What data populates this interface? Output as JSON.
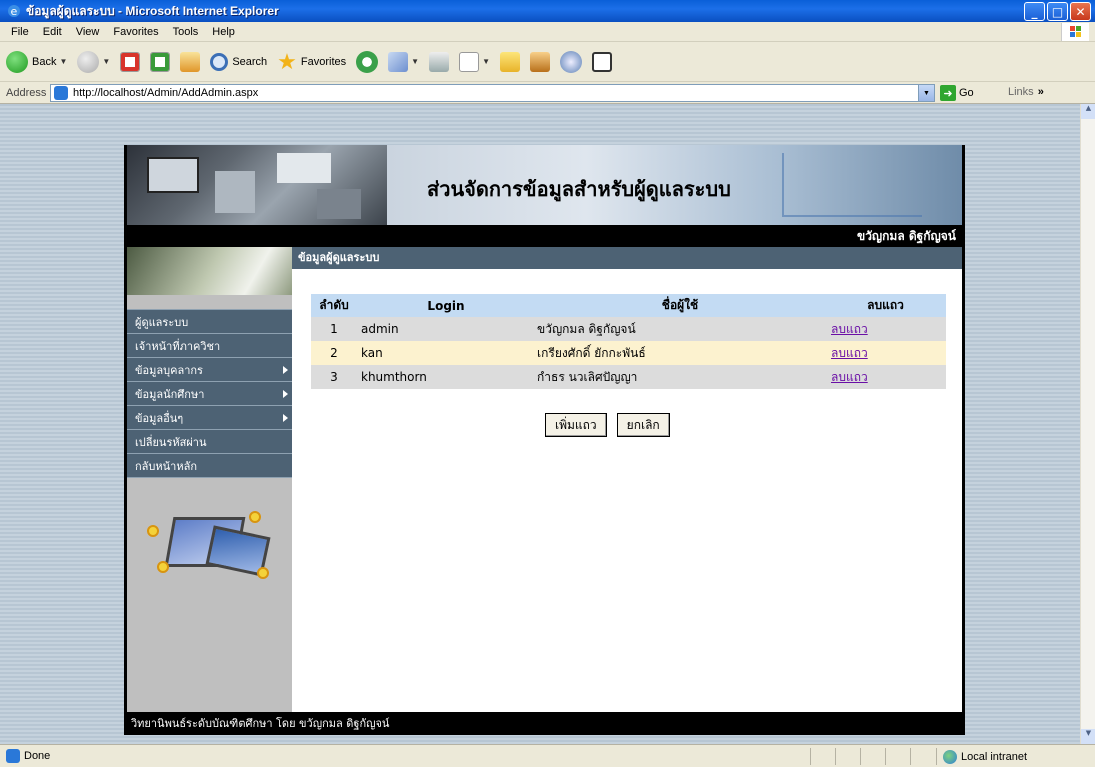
{
  "window": {
    "title": "ข้อมูลผู้ดูแลระบบ - Microsoft Internet Explorer",
    "controls": [
      "minimize",
      "maximize",
      "close"
    ]
  },
  "menubar": [
    "File",
    "Edit",
    "View",
    "Favorites",
    "Tools",
    "Help"
  ],
  "toolbar": {
    "back_label": "Back",
    "search_label": "Search",
    "favorites_label": "Favorites",
    "icons": [
      "back-icon",
      "forward-icon",
      "stop-icon",
      "refresh-icon",
      "home-icon",
      "search-icon",
      "favorites-icon",
      "history-icon",
      "mail-icon",
      "print-icon",
      "edit-icon",
      "folder-icon",
      "research-icon",
      "messenger-icon",
      "media-icon"
    ]
  },
  "addressbar": {
    "label": "Address",
    "url": "http://localhost/Admin/AddAdmin.aspx",
    "go_label": "Go",
    "links_label": "Links"
  },
  "page": {
    "banner_title": "ส่วนจัดการข้อมูลสำหรับผู้ดูแลระบบ",
    "user_name": "ขวัญกมล ดิฐกัญจน์",
    "section_title": "ข้อมูลผู้ดูแลระบบ",
    "nav": [
      {
        "label": "ผู้ดูแลระบบ",
        "submenu": false
      },
      {
        "label": "เจ้าหน้าที่ภาควิชา",
        "submenu": false
      },
      {
        "label": "ข้อมูลบุคลากร",
        "submenu": true
      },
      {
        "label": "ข้อมูลนักศึกษา",
        "submenu": true
      },
      {
        "label": "ข้อมูลอื่นๆ",
        "submenu": true
      },
      {
        "label": "เปลี่ยนรหัสผ่าน",
        "submenu": false
      },
      {
        "label": "กลับหน้าหลัก",
        "submenu": false
      }
    ],
    "table": {
      "headers": [
        "ลำดับ",
        "Login",
        "ชื่อผู้ใช้",
        "ลบแถว"
      ],
      "rows": [
        {
          "no": "1",
          "login": "admin",
          "name": "ขวัญกมล ดิฐกัญจน์",
          "action": "ลบแถว"
        },
        {
          "no": "2",
          "login": "kan",
          "name": "เกรียงศักดิ์ ยักกะพันธ์",
          "action": "ลบแถว"
        },
        {
          "no": "3",
          "login": "khumthorn",
          "name": "กำธร นวเลิศปัญญา",
          "action": "ลบแถว"
        }
      ]
    },
    "buttons": {
      "add_label": "เพิ่มแถว",
      "cancel_label": "ยกเลิก"
    },
    "footer": "วิทยานิพนธ์ระดับบัณฑิตศึกษา โดย ขวัญกมล ดิฐกัญจน์"
  },
  "statusbar": {
    "status": "Done",
    "zone": "Local intranet"
  },
  "colors": {
    "nav_bg": "#4d6274",
    "header_bg": "#c3dbf3",
    "row_alt": "#fcf2cf",
    "row_base": "#dcdcdc",
    "link": "#6a0fa6"
  }
}
